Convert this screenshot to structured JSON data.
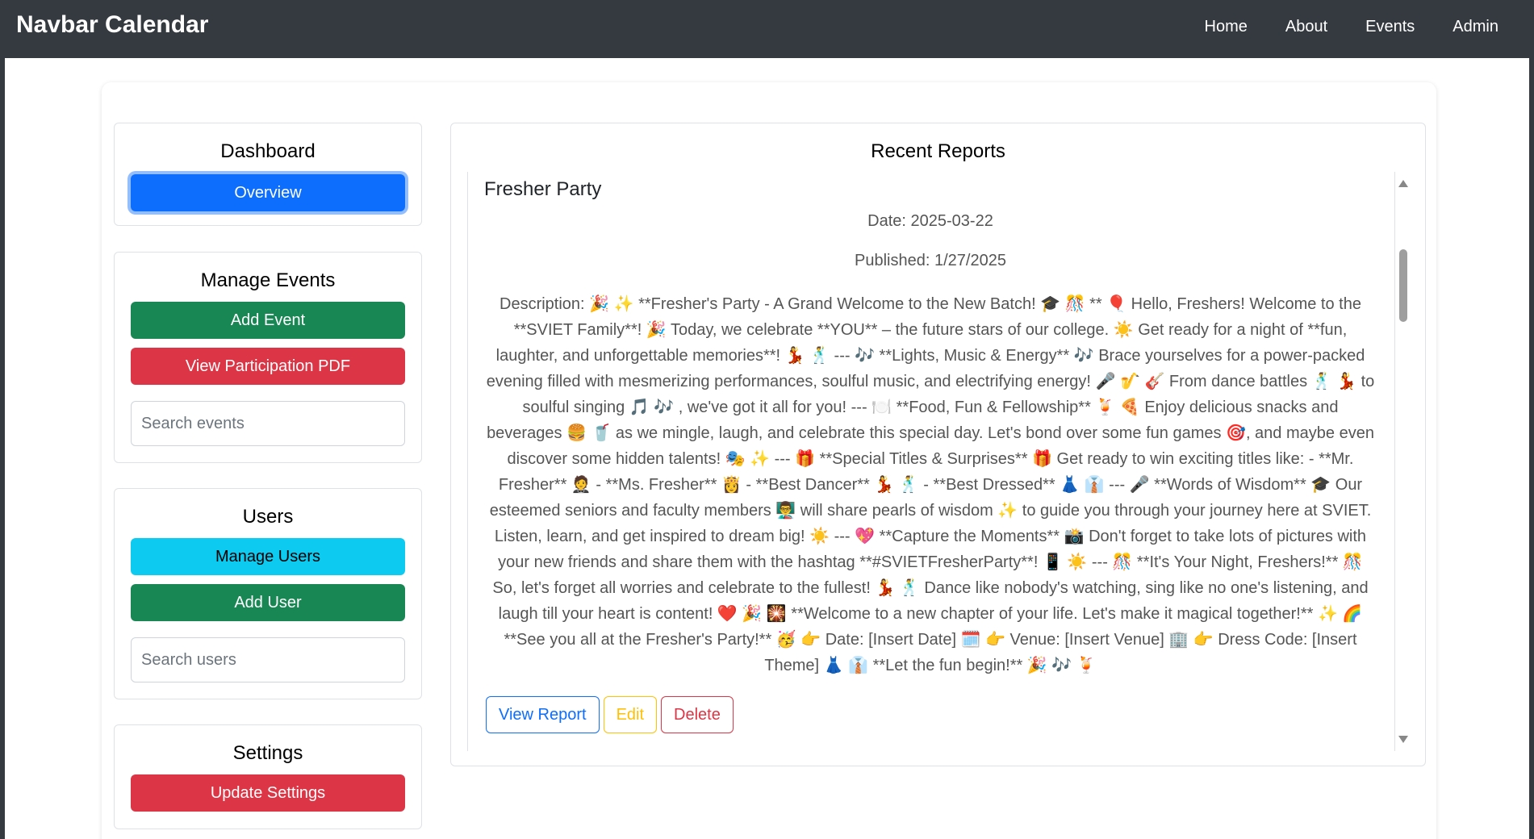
{
  "navbar": {
    "brand": "Navbar Calendar",
    "links": [
      "Home",
      "About",
      "Events",
      "Admin"
    ]
  },
  "sidebar": {
    "dashboard": {
      "title": "Dashboard",
      "overview_label": "Overview"
    },
    "manage_events": {
      "title": "Manage Events",
      "add_label": "Add Event",
      "pdf_label": "View Participation PDF",
      "search_placeholder": "Search events"
    },
    "users": {
      "title": "Users",
      "manage_label": "Manage Users",
      "add_label": "Add User",
      "search_placeholder": "Search users"
    },
    "settings": {
      "title": "Settings",
      "update_label": "Update Settings"
    }
  },
  "reports": {
    "title": "Recent Reports",
    "items": [
      {
        "title": "Fresher Party",
        "date": "Date: 2025-03-22",
        "published": "Published: 1/27/2025",
        "description": "Description: 🎉 ✨ **Fresher's Party - A Grand Welcome to the New Batch! 🎓 🎊 ** 🎈 Hello, Freshers! Welcome to the **SVIET Family**! 🎉 Today, we celebrate **YOU** – the future stars of our college. ☀️ Get ready for a night of **fun, laughter, and unforgettable memories**! 💃 🕺 --- 🎶 **Lights, Music & Energy** 🎶 Brace yourselves for a power-packed evening filled with mesmerizing performances, soulful music, and electrifying energy! 🎤 🎷 🎸 From dance battles 🕺 💃 to soulful singing 🎵 🎶 , we've got it all for you! --- 🍽️ **Food, Fun & Fellowship** 🍹 🍕 Enjoy delicious snacks and beverages 🍔 🥤 as we mingle, laugh, and celebrate this special day. Let's bond over some fun games 🎯, and maybe even discover some hidden talents! 🎭 ✨ --- 🎁 **Special Titles & Surprises** 🎁 Get ready to win exciting titles like: - **Mr. Fresher** 🤵 - **Ms. Fresher** 👸 - **Best Dancer** 💃 🕺 - **Best Dressed** 👗 👔 --- 🎤 **Words of Wisdom** 🎓 Our esteemed seniors and faculty members 👨‍🏫 will share pearls of wisdom ✨ to guide you through your journey here at SVIET. Listen, learn, and get inspired to dream big! ☀️ --- 💖 **Capture the Moments** 📸 Don't forget to take lots of pictures with your new friends and share them with the hashtag **#SVIETFresherParty**! 📱 ☀️ --- 🎊 **It's Your Night, Freshers!** 🎊 So, let's forget all worries and celebrate to the fullest! 💃 🕺 Dance like nobody's watching, sing like no one's listening, and laugh till your heart is content! ❤️ 🎉 🎇 **Welcome to a new chapter of your life. Let's make it magical together!** ✨ 🌈 **See you all at the Fresher's Party!** 🥳 👉 Date: [Insert Date] 🗓️ 👉 Venue: [Insert Venue] 🏢 👉 Dress Code: [Insert Theme] 👗 👔 **Let the fun begin!** 🎉 🎶 🍹",
        "actions": {
          "view": "View Report",
          "edit": "Edit",
          "delete": "Delete"
        }
      }
    ]
  }
}
